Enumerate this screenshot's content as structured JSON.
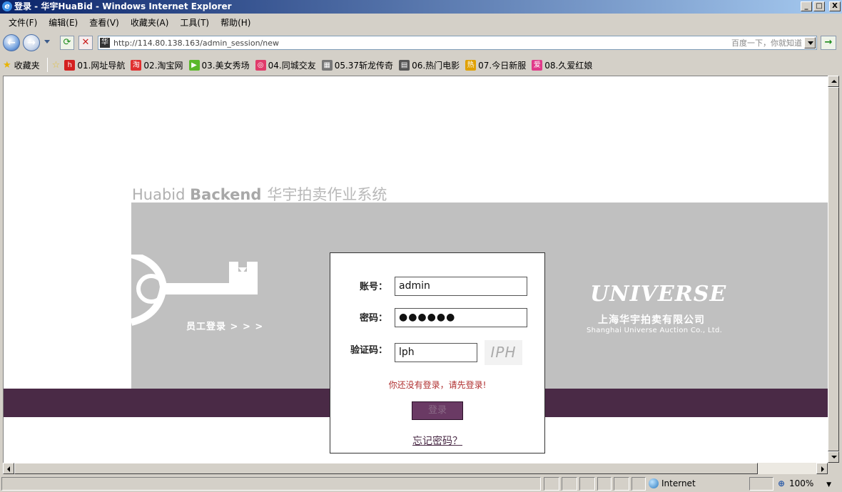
{
  "window": {
    "title": "登录 - 华宇HuaBid - Windows Internet Explorer",
    "minimize": "_",
    "maximize": "□",
    "close": "X"
  },
  "menu": [
    "文件(F)",
    "编辑(E)",
    "查看(V)",
    "收藏夹(A)",
    "工具(T)",
    "帮助(H)"
  ],
  "address": {
    "site_icon_text": "华",
    "url": "http://114.80.138.163/admin_session/new",
    "search_hint": "百度一下，你就知道"
  },
  "favorites": {
    "title": "收藏夹",
    "items": [
      {
        "label": "01.网址导航",
        "icon": "hao-icon",
        "color": "#d42020",
        "glyph": "h"
      },
      {
        "label": "02.淘宝网",
        "icon": "taobao-icon",
        "color": "#e03030",
        "glyph": "淘"
      },
      {
        "label": "03.美女秀场",
        "icon": "play-icon",
        "color": "#5ab82a",
        "glyph": "▶"
      },
      {
        "label": "04.同城交友",
        "icon": "swirl-icon",
        "color": "#e03a6a",
        "glyph": "◎"
      },
      {
        "label": "05.37斩龙传奇",
        "icon": "building-icon",
        "color": "#777777",
        "glyph": "▦"
      },
      {
        "label": "06.热门电影",
        "icon": "film-icon",
        "color": "#555555",
        "glyph": "▤"
      },
      {
        "label": "07.今日新服",
        "icon": "hot-icon",
        "color": "#e0a000",
        "glyph": "热"
      },
      {
        "label": "08.久爱红娘",
        "icon": "love-icon",
        "color": "#e03a8a",
        "glyph": "爱"
      }
    ]
  },
  "page": {
    "heading_light": "Huabid ",
    "heading_bold": "Backend",
    "heading_cn": "华宇拍卖作业系统",
    "staff_login": "员工登录 > > >",
    "logo_text": "UNIVERSE",
    "logo_cn": "上海华宇拍卖有限公司",
    "logo_en": "Shanghai Universe Auction Co., Ltd."
  },
  "login": {
    "account_label": "账号：",
    "account_value": "admin",
    "password_label": "密码：",
    "password_value": "●●●●●●",
    "captcha_label": "验证码：",
    "captcha_value": "lph",
    "captcha_image_text": "IPH",
    "error": "你还没有登录，请先登录!",
    "submit": "登录",
    "forgot": "忘记密码？"
  },
  "status": {
    "zone": "Internet",
    "zoom": "100%"
  },
  "colors": {
    "brand_purple": "#4a2a46",
    "panel_gray": "#c0c0c0",
    "error_red": "#b03030"
  }
}
